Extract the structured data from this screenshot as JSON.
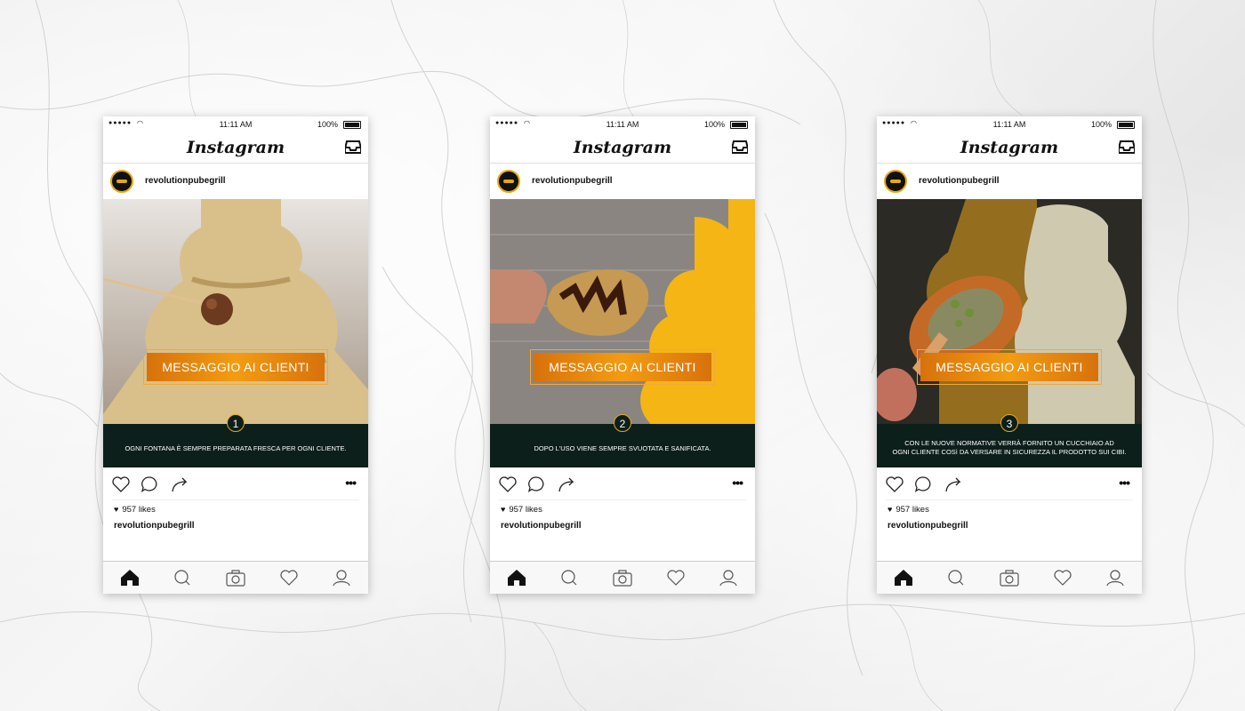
{
  "app": {
    "name": "Instagram"
  },
  "status_bar": {
    "time": "11:11 AM",
    "battery": "100%"
  },
  "account": {
    "username": "revolutionpubegrill"
  },
  "posts": [
    {
      "button_label": "MESSAGGIO AI CLIENTI",
      "step_number": "1",
      "caption_line1": "OGNI FONTANA È SEMPRE PREPARATA FRESCA PER OGNI CLIENTE.",
      "caption_line2": "",
      "likes": "957 likes",
      "owner": "revolutionpubegrill",
      "colors": {
        "fountain": "#d9c08a",
        "accent": "#f39c12"
      }
    },
    {
      "button_label": "MESSAGGIO AI CLIENTI",
      "step_number": "2",
      "caption_line1": "DOPO L'USO VIENE SEMPRE SVUOTATA E SANIFICATA.",
      "caption_line2": "",
      "likes": "957 likes",
      "owner": "revolutionpubegrill",
      "colors": {
        "fountain": "#f5b514",
        "accent": "#f39c12"
      }
    },
    {
      "button_label": "MESSAGGIO AI CLIENTI",
      "step_number": "3",
      "caption_line1": "CON LE NUOVE NORMATIVE VERRÀ FORNITO UN CUCCHIAIO AD",
      "caption_line2": "OGNI CLIENTE COSì DA VERSARE IN SICUREZZA IL PRODOTTO SUI CIBI.",
      "likes": "957 likes",
      "owner": "revolutionpubegrill",
      "colors": {
        "fountain": "#cfc9b0",
        "accent": "#f39c12"
      }
    }
  ],
  "icons": [
    "heart-icon",
    "comment-icon",
    "share-icon",
    "more-icon",
    "home-icon",
    "search-icon",
    "camera-icon",
    "activity-icon",
    "profile-icon",
    "inbox-icon"
  ]
}
